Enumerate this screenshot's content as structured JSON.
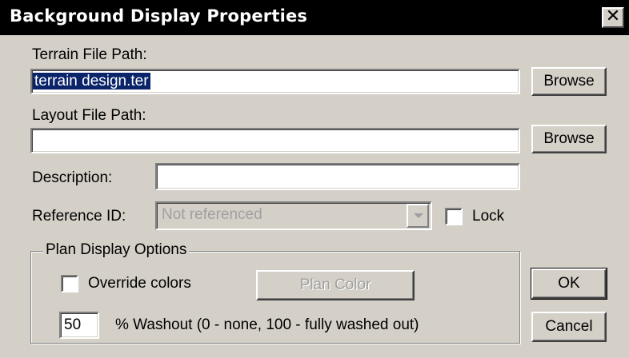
{
  "window": {
    "title": "Background Display Properties",
    "close_glyph": "✕"
  },
  "terrain": {
    "label": "Terrain File Path:",
    "value": "terrain design.ter",
    "browse_label": "Browse"
  },
  "layout": {
    "label": "Layout File Path:",
    "value": "",
    "browse_label": "Browse"
  },
  "description": {
    "label": "Description:",
    "value": ""
  },
  "reference": {
    "label": "Reference ID:",
    "value": "Not referenced",
    "lock_label": "Lock",
    "lock_checked": false
  },
  "plan": {
    "group_label": "Plan Display Options",
    "override_label": "Override colors",
    "override_checked": false,
    "plan_color_label": "Plan Color",
    "washout_value": "50",
    "washout_label": "% Washout (0 - none,  100 - fully washed out)"
  },
  "buttons": {
    "ok": "OK",
    "cancel": "Cancel"
  },
  "colors": {
    "title_bar": "#000000",
    "face": "#d4d0c8",
    "selection": "#0a246a"
  }
}
